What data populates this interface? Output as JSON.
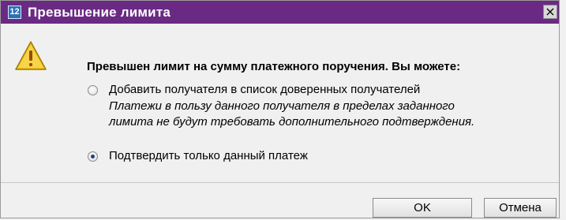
{
  "dialog": {
    "title": "Превышение лимита",
    "title_icon_glyph": "12",
    "close_glyph": "×",
    "heading": "Превышен лимит на сумму платежного поручения. Вы можете:",
    "options": [
      {
        "label": "Добавить получателя в список доверенных получателей",
        "description": "Платежи в пользу данного получателя в пределах заданного\nлимита не будут требовать дополнительного подтверждения.",
        "selected": false
      },
      {
        "label": "Подтвердить только данный платеж",
        "selected": true
      }
    ],
    "buttons": {
      "ok": "OK",
      "cancel": "Отмена"
    }
  },
  "colors": {
    "titlebar": "#6a2a84",
    "background": "#f0f0f0",
    "warning": "#f2c31c"
  },
  "icons": {
    "title": "app-icon",
    "warning": "warning-icon",
    "close": "close-icon"
  }
}
